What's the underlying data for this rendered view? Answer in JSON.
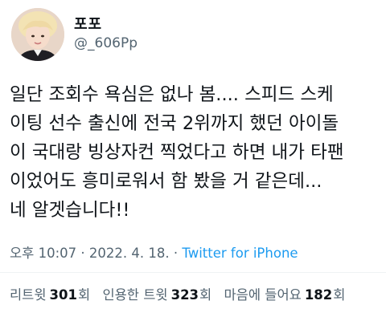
{
  "author": {
    "display_name": "포포",
    "handle": "@_606Pp"
  },
  "tweet": {
    "lines": [
      "일단 조회수 욕심은 없나 봄.... 스피드 스케",
      "이팅 선수 출신에 전국 2위까지 했던 아이돌",
      "이 국대랑 빙상자컨 찍었다고 하면 내가 타팬",
      "이었어도 흥미로워서 함 봤을 거 같은데...",
      "네 알겟습니다!!"
    ],
    "time": "오후 10:07",
    "separator": " · ",
    "date": "2022. 4. 18.",
    "source": "Twitter for iPhone"
  },
  "stats": {
    "retweets": {
      "label": "리트윗",
      "count": "301",
      "unit": "회"
    },
    "quotes": {
      "label": "인용한 트윗",
      "count": "323",
      "unit": "회"
    },
    "likes": {
      "label": "마음에 들어요",
      "count": "182",
      "unit": "회"
    }
  },
  "colors": {
    "text": "#0f1419",
    "secondary": "#536471",
    "link": "#1d9bf0",
    "divider": "#eff3f4"
  }
}
